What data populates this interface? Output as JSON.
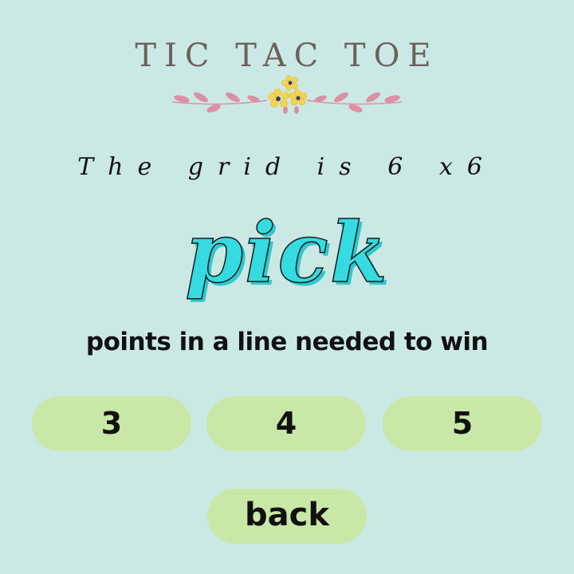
{
  "header": {
    "title": "TIC TAC TOE"
  },
  "grid_info": {
    "text": "The grid is 6 x6"
  },
  "pick": {
    "word": "pick"
  },
  "instruction": {
    "text": "points in a line needed to win"
  },
  "options": [
    {
      "label": "3"
    },
    {
      "label": "4"
    },
    {
      "label": "5"
    }
  ],
  "back_button": {
    "label": "back"
  },
  "colors": {
    "background": "#cbe9e4",
    "button": "#c9e8a7",
    "pick_fill": "#35dbe0",
    "title": "#6b625a",
    "leaf": "#dc8fa5",
    "flower": "#f6d44a"
  },
  "decoration": {
    "icon": "floral-divider-icon"
  }
}
